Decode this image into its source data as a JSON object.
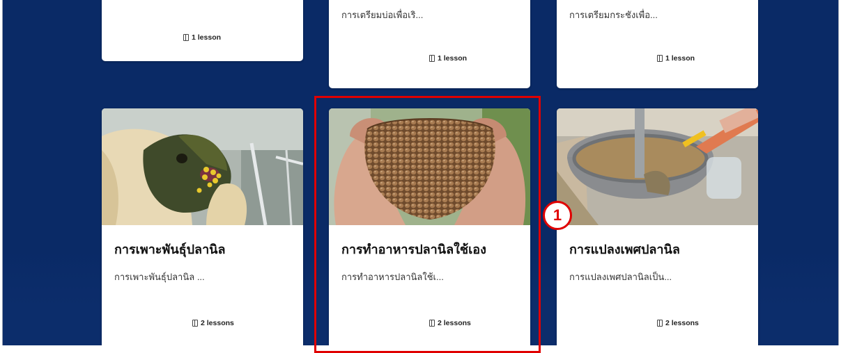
{
  "top_cards": [
    {
      "description": "",
      "lessons": "1 lesson"
    },
    {
      "description": "การเตรียมบ่อเพื่อเริ...",
      "lessons": "1 lesson"
    },
    {
      "description": "การเตรียมกระชังเพื่อ...",
      "lessons": "1 lesson"
    }
  ],
  "courses": [
    {
      "title": "การเพาะพันธุ์ปลานิล",
      "description": "การเพาะพันธุ์ปลานิล ...",
      "lessons": "2 lessons",
      "thumbnail": "tilapia-fish-held-in-glove"
    },
    {
      "title": "การทำอาหารปลานิลใช้เอง",
      "description": "การทำอาหารปลานิลใช้เ...",
      "lessons": "2 lessons",
      "thumbnail": "hands-holding-fish-feed-pellets"
    },
    {
      "title": "การแปลงเพศปลานิล",
      "description": "การแปลงเพศปลานิลเป็น...",
      "lessons": "2 lessons",
      "thumbnail": "mixing-feed-in-metal-bowl"
    }
  ],
  "annotation": {
    "step_number": "1",
    "highlight_color": "#e00000"
  },
  "colors": {
    "background": "#0a2a66",
    "card": "#ffffff"
  }
}
